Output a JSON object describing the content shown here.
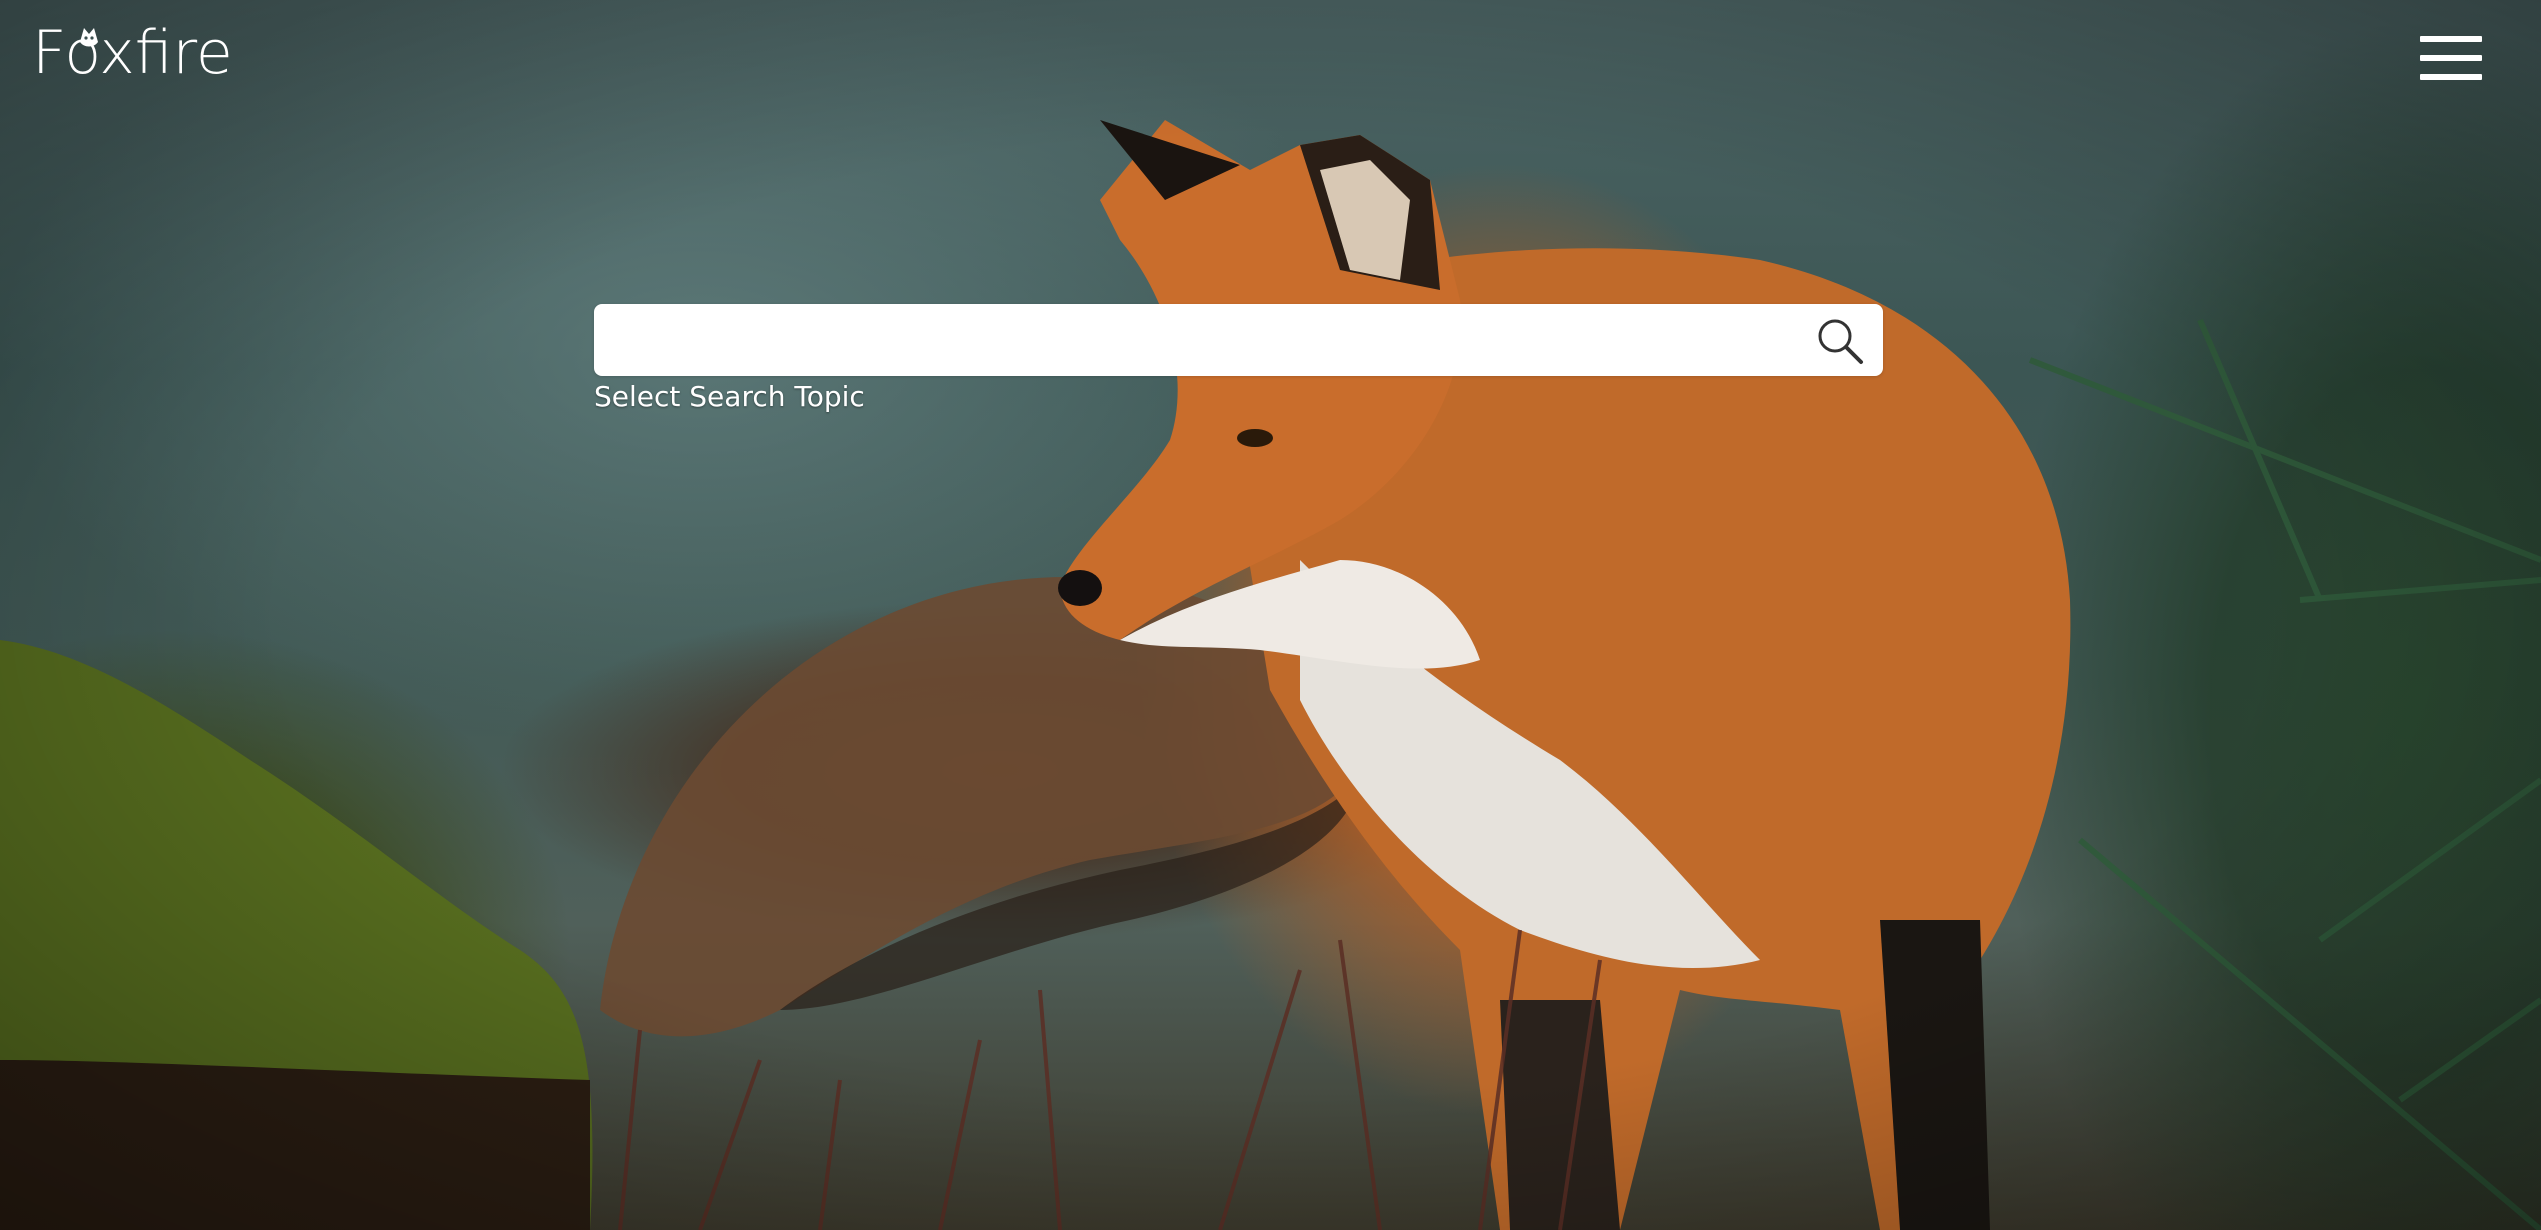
{
  "header": {
    "logo_text": "Foxfire",
    "menu_icon": "hamburger-menu-icon"
  },
  "search": {
    "value": "",
    "placeholder": "",
    "icon": "search-icon",
    "topic_label": "Select Search Topic"
  },
  "background": {
    "subject": "red fox in forest",
    "accent": "#d4762c"
  }
}
